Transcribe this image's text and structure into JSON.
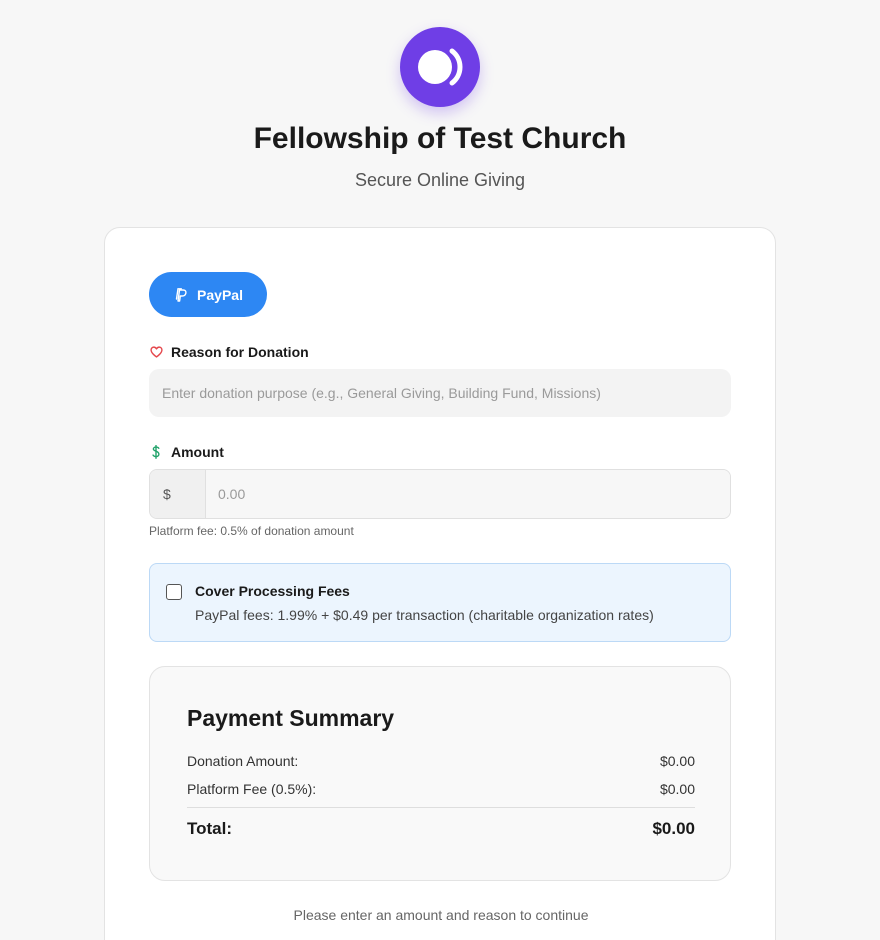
{
  "header": {
    "org_name": "Fellowship of Test Church",
    "tagline": "Secure Online Giving"
  },
  "payment_method": {
    "label": "PayPal",
    "color": "#2d87f3"
  },
  "reason": {
    "label": "Reason for Donation",
    "placeholder": "Enter donation purpose (e.g., General Giving, Building Fund, Missions)",
    "value": ""
  },
  "amount": {
    "label": "Amount",
    "currency": "$",
    "placeholder": "0.00",
    "value": "",
    "fee_note": "Platform fee: 0.5% of donation amount"
  },
  "cover_fees": {
    "title": "Cover Processing Fees",
    "description": "PayPal fees: 1.99% + $0.49 per transaction (charitable organization rates)",
    "checked": false
  },
  "summary": {
    "title": "Payment Summary",
    "donation_label": "Donation Amount:",
    "donation_value": "$0.00",
    "fee_label": "Platform Fee (0.5%):",
    "fee_value": "$0.00",
    "total_label": "Total:",
    "total_value": "$0.00"
  },
  "continue_message": "Please enter an amount and reason to continue",
  "colors": {
    "brand_purple": "#6f3ee6",
    "heart_red": "#e5484d",
    "dollar_green": "#22a36b"
  }
}
